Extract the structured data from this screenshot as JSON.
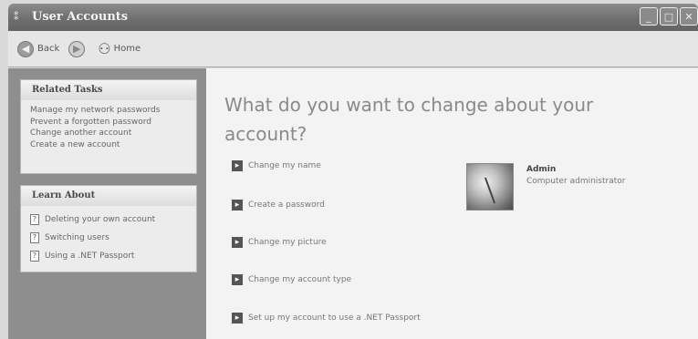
{
  "window": {
    "title": "User Accounts",
    "controls": [
      "_",
      "□",
      "✕"
    ]
  },
  "toolbar": {
    "back_label": "Back",
    "home_label": "Home"
  },
  "related_tasks": {
    "heading": "Related Tasks",
    "items": [
      "Manage my network passwords",
      "Prevent a forgotten password",
      "Change another account",
      "Create a new account"
    ]
  },
  "learn_about": {
    "heading": "Learn About",
    "items": [
      "Deleting your own account",
      "Switching users",
      "Using a .NET Passport"
    ]
  },
  "main": {
    "headline": "What do you want to change about your account?",
    "options": [
      "Change my name",
      "Create a password",
      "Change my picture",
      "Change my account type",
      "Set up my account to use a .NET Passport"
    ]
  },
  "account": {
    "name": "Admin",
    "role": "Computer administrator"
  },
  "icons": {
    "back": "back-arrow-icon",
    "forward": "forward-arrow-icon",
    "home": "home-icon",
    "option": "arrow-square-icon",
    "help": "help-topic-icon"
  }
}
